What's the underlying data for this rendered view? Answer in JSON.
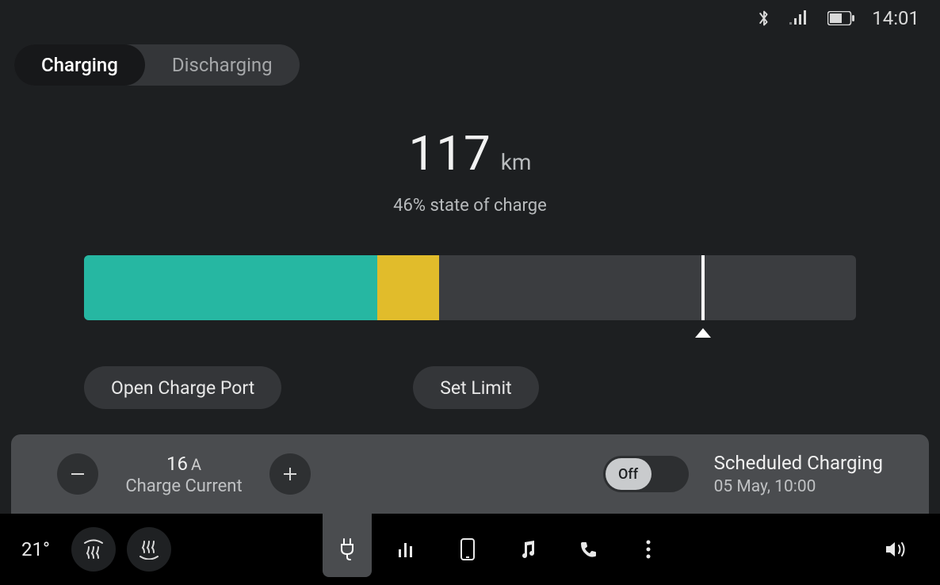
{
  "status": {
    "time": "14:01",
    "battery_pct": 55
  },
  "tabs": {
    "charging": "Charging",
    "discharging": "Discharging"
  },
  "main": {
    "range_value": "117",
    "range_unit": "km",
    "soc_text": "46% state of charge",
    "soc_pct": 46,
    "charge_to_pct": 46,
    "limit_pct": 80
  },
  "buttons": {
    "open_port": "Open Charge Port",
    "set_limit": "Set Limit"
  },
  "panel": {
    "current_value": "16",
    "current_unit": "A",
    "current_label": "Charge Current",
    "toggle_state": "Off",
    "sched_title": "Scheduled Charging",
    "sched_time": "05 May, 10:00"
  },
  "nav": {
    "temperature": "21°"
  },
  "colors": {
    "charged": "#26b7a2",
    "pending": "#e1bc2b",
    "empty": "#3b3d40",
    "panel": "#4a4c4f"
  }
}
